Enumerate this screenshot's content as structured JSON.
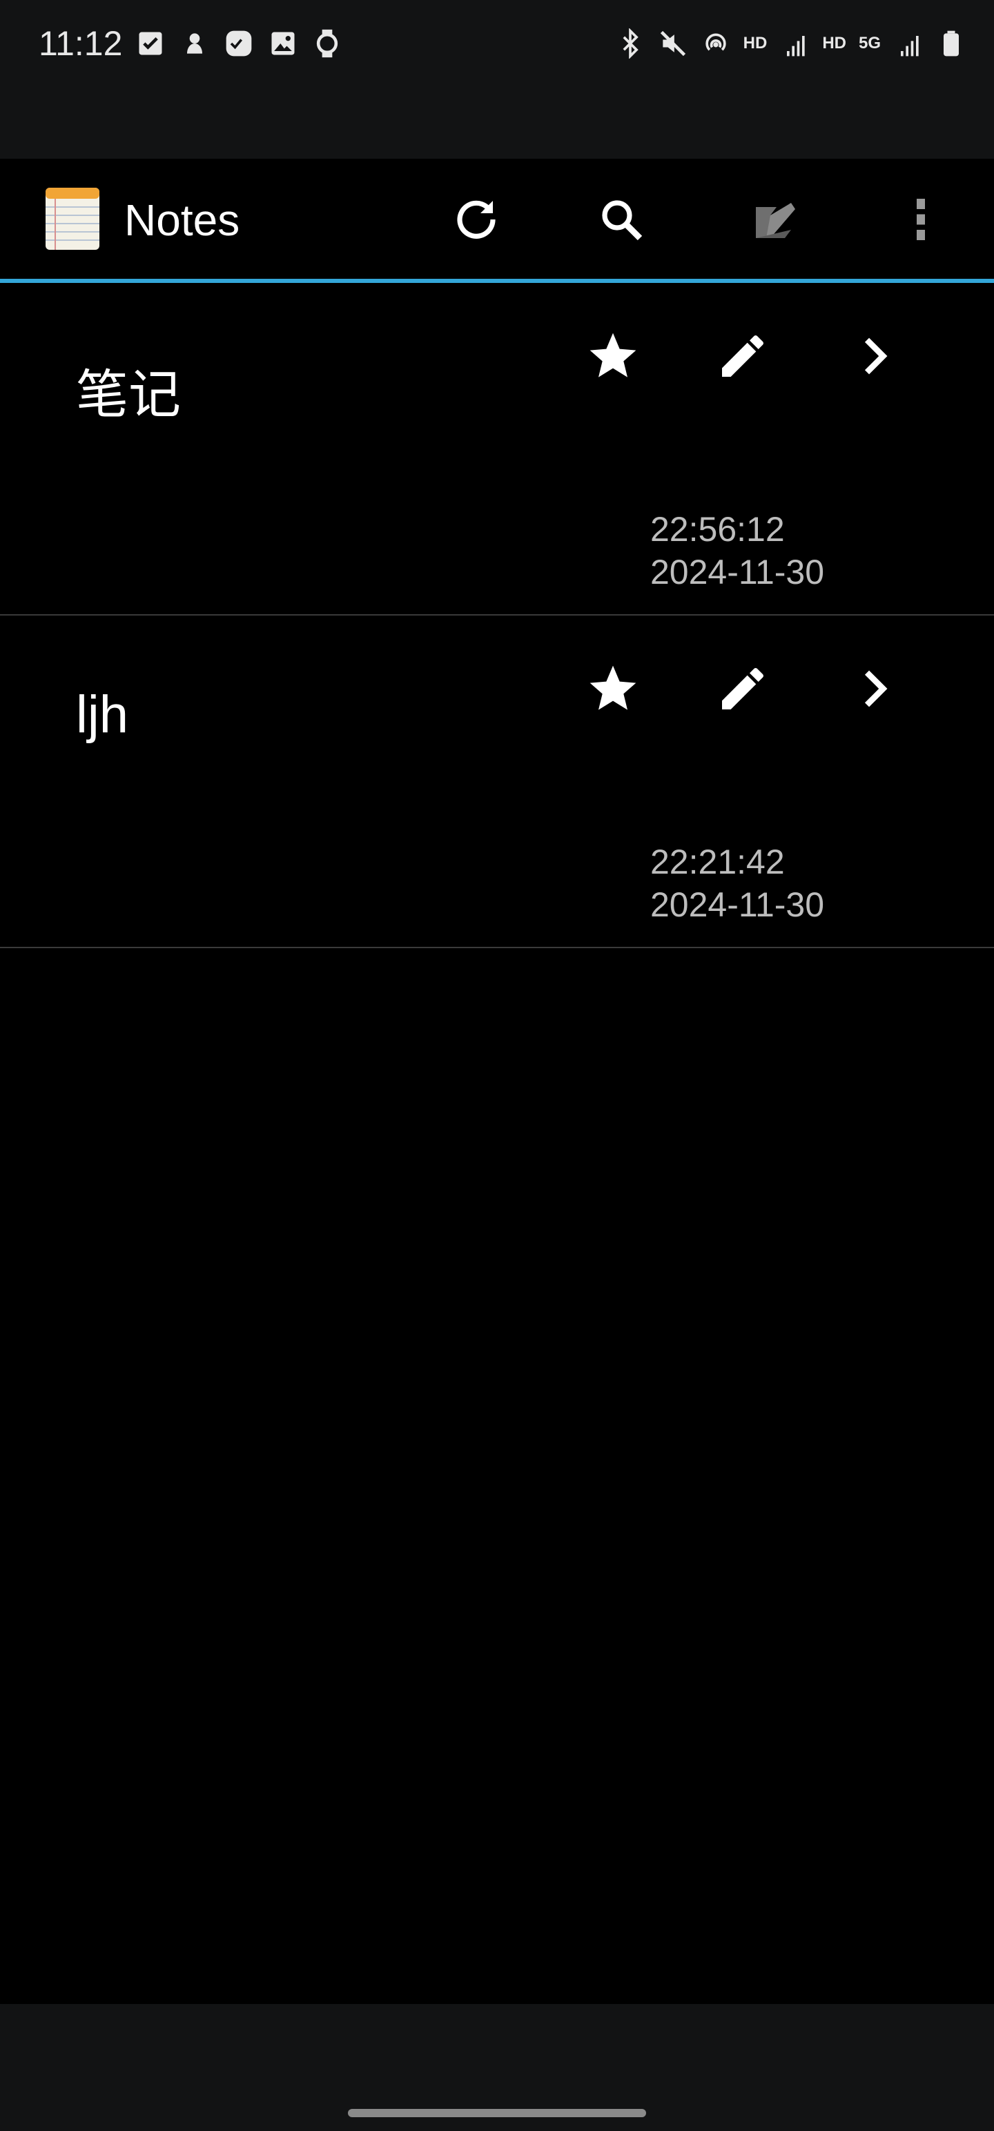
{
  "status_bar": {
    "time": "11:12",
    "left_icons": [
      "checkbox-icon",
      "android-bug-icon",
      "task-app-icon",
      "image-icon",
      "watch-icon"
    ],
    "right_icons": [
      "bluetooth-icon",
      "mute-icon",
      "hotspot-icon",
      "hd-label",
      "signal-5g-icon",
      "hd-label",
      "signal-5g-data-icon",
      "battery-icon"
    ],
    "hd_label": "HD",
    "net_label": "5G"
  },
  "app_bar": {
    "title": "Notes",
    "actions": [
      "refresh-icon",
      "search-icon",
      "new-note-icon",
      "more-vert-icon"
    ]
  },
  "notes": [
    {
      "title": "笔记",
      "time": "22:56:12",
      "date": "2024-11-30"
    },
    {
      "title": "ljh",
      "time": "22:21:42",
      "date": "2024-11-30"
    }
  ],
  "colors": {
    "accent": "#33a6d8",
    "background": "#000000",
    "bar": "#121314",
    "secondary_text": "#bdbdbd"
  }
}
